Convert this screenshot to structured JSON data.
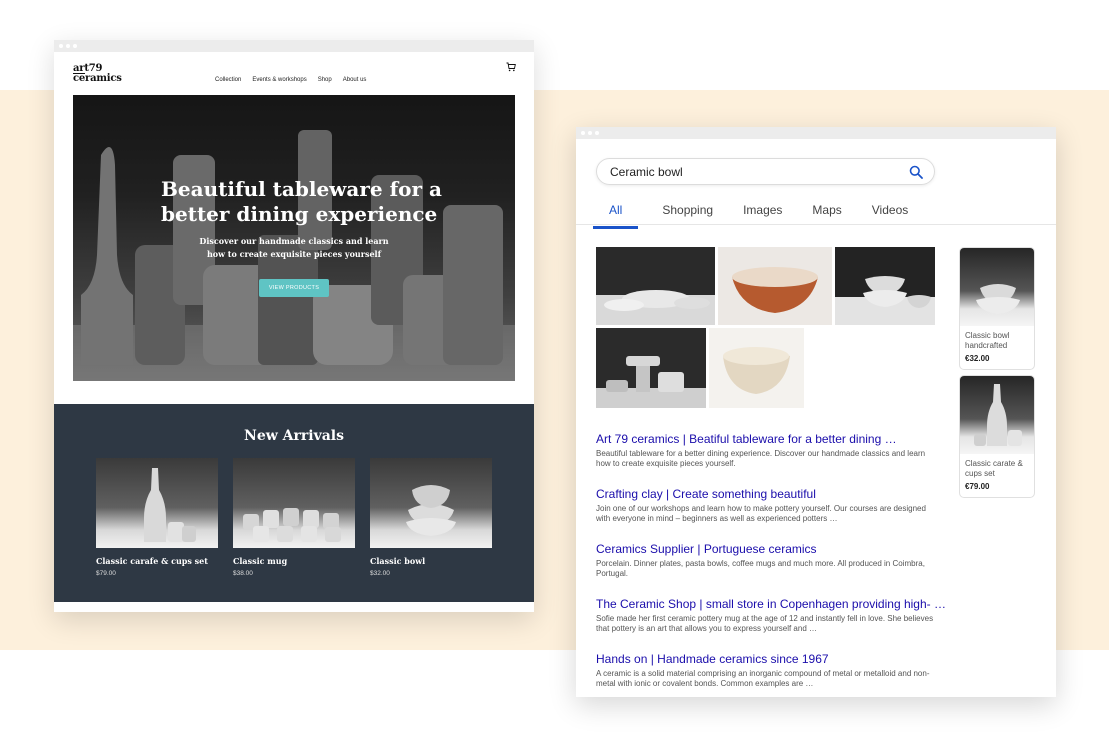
{
  "site": {
    "logo_line1": "art79",
    "logo_line2": "ceramics",
    "nav": [
      "Collection",
      "Events & workshops",
      "Shop",
      "About us"
    ],
    "hero": {
      "title": "Beautiful tableware for a better dining experience",
      "subtitle": "Discover our handmade classics and learn how to create exquisite pieces yourself",
      "button": "VIEW PRODUCTS"
    },
    "arrivals_title": "New Arrivals",
    "products": [
      {
        "name": "Classic carafe & cups set",
        "price": "$79.00"
      },
      {
        "name": "Classic mug",
        "price": "$38.00"
      },
      {
        "name": "Classic bowl",
        "price": "$32.00"
      }
    ],
    "accent_color": "#5fc4c4",
    "dark_bg": "#2e3844"
  },
  "search": {
    "query": "Ceramic bowl",
    "tabs": [
      "All",
      "Shopping",
      "Images",
      "Maps",
      "Videos"
    ],
    "active_tab": "All",
    "link_color": "#1a0dab",
    "results": [
      {
        "title": "Art 79 ceramics | Beatiful tableware for a better dining …",
        "desc": "Beautiful tableware for a better dining experience. Discover our handmade classics and learn how to create exquisite pieces yourself."
      },
      {
        "title": "Crafting clay | Create something beautiful",
        "desc": "Join one of our workshops and learn how to make pottery yourself. Our courses are designed with everyone in mind – beginners as well as experienced potters …"
      },
      {
        "title": "Ceramics Supplier | Portuguese ceramics",
        "desc": "Porcelain. Dinner plates, pasta bowls, coffee mugs and much more. All produced in Coimbra, Portugal."
      },
      {
        "title": "The Ceramic Shop | small store in Copenhagen providing high- …",
        "desc": "Sofie made her first ceramic pottery mug at the age of 12 and instantly fell in love. She believes that pottery is an art that allows you to express yourself and …"
      },
      {
        "title": "Hands on | Handmade ceramics since 1967",
        "desc": "A ceramic is a solid material comprising an inorganic compound of metal or metalloid and non-metal with ionic or covalent bonds. Common examples are …"
      }
    ],
    "shopping": [
      {
        "name": "Classic bowl handcrafted",
        "price": "€32.00"
      },
      {
        "name": "Classic carate & cups set",
        "price": "€79.00"
      }
    ]
  }
}
